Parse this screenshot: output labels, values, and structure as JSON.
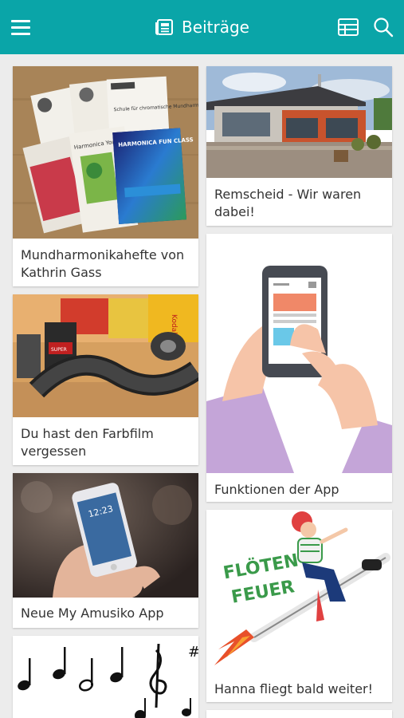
{
  "header": {
    "title": "Beiträge",
    "icons": [
      "menu-icon",
      "newspaper-icon",
      "table-view-icon",
      "search-icon"
    ]
  },
  "posts": [
    {
      "title": "Mundharmonikahefte von Kathrin Gass",
      "image": "harmonica-booklets"
    },
    {
      "title": "Remscheid - Wir waren dabei!",
      "image": "remscheid-building"
    },
    {
      "title": "Du hast den Farbfilm vergessen",
      "image": "film-rolls"
    },
    {
      "title": "Funktionen der App",
      "image": "phone-illustration"
    },
    {
      "title": "Neue My Amusiko App",
      "image": "hand-with-phone"
    },
    {
      "title": "Hanna fliegt bald weiter!",
      "image": "floeten-feuer"
    },
    {
      "title": "",
      "image": "music-notes"
    }
  ],
  "image_texts": {
    "booklet_1": "Schule für chromatische Mundharmonika",
    "booklet_2": "Harmonica Young",
    "booklet_3": "HARMONICA FUN CLASS",
    "film_brand": "Kodak",
    "film_label": "SUPER",
    "phone_time": "12:23",
    "floete_line1": "FLÖTEN-",
    "floete_line2": "FEUER"
  },
  "colors": {
    "appbar": "#0aa5a8",
    "background": "#ececec",
    "card": "#ffffff",
    "text": "#333333"
  }
}
